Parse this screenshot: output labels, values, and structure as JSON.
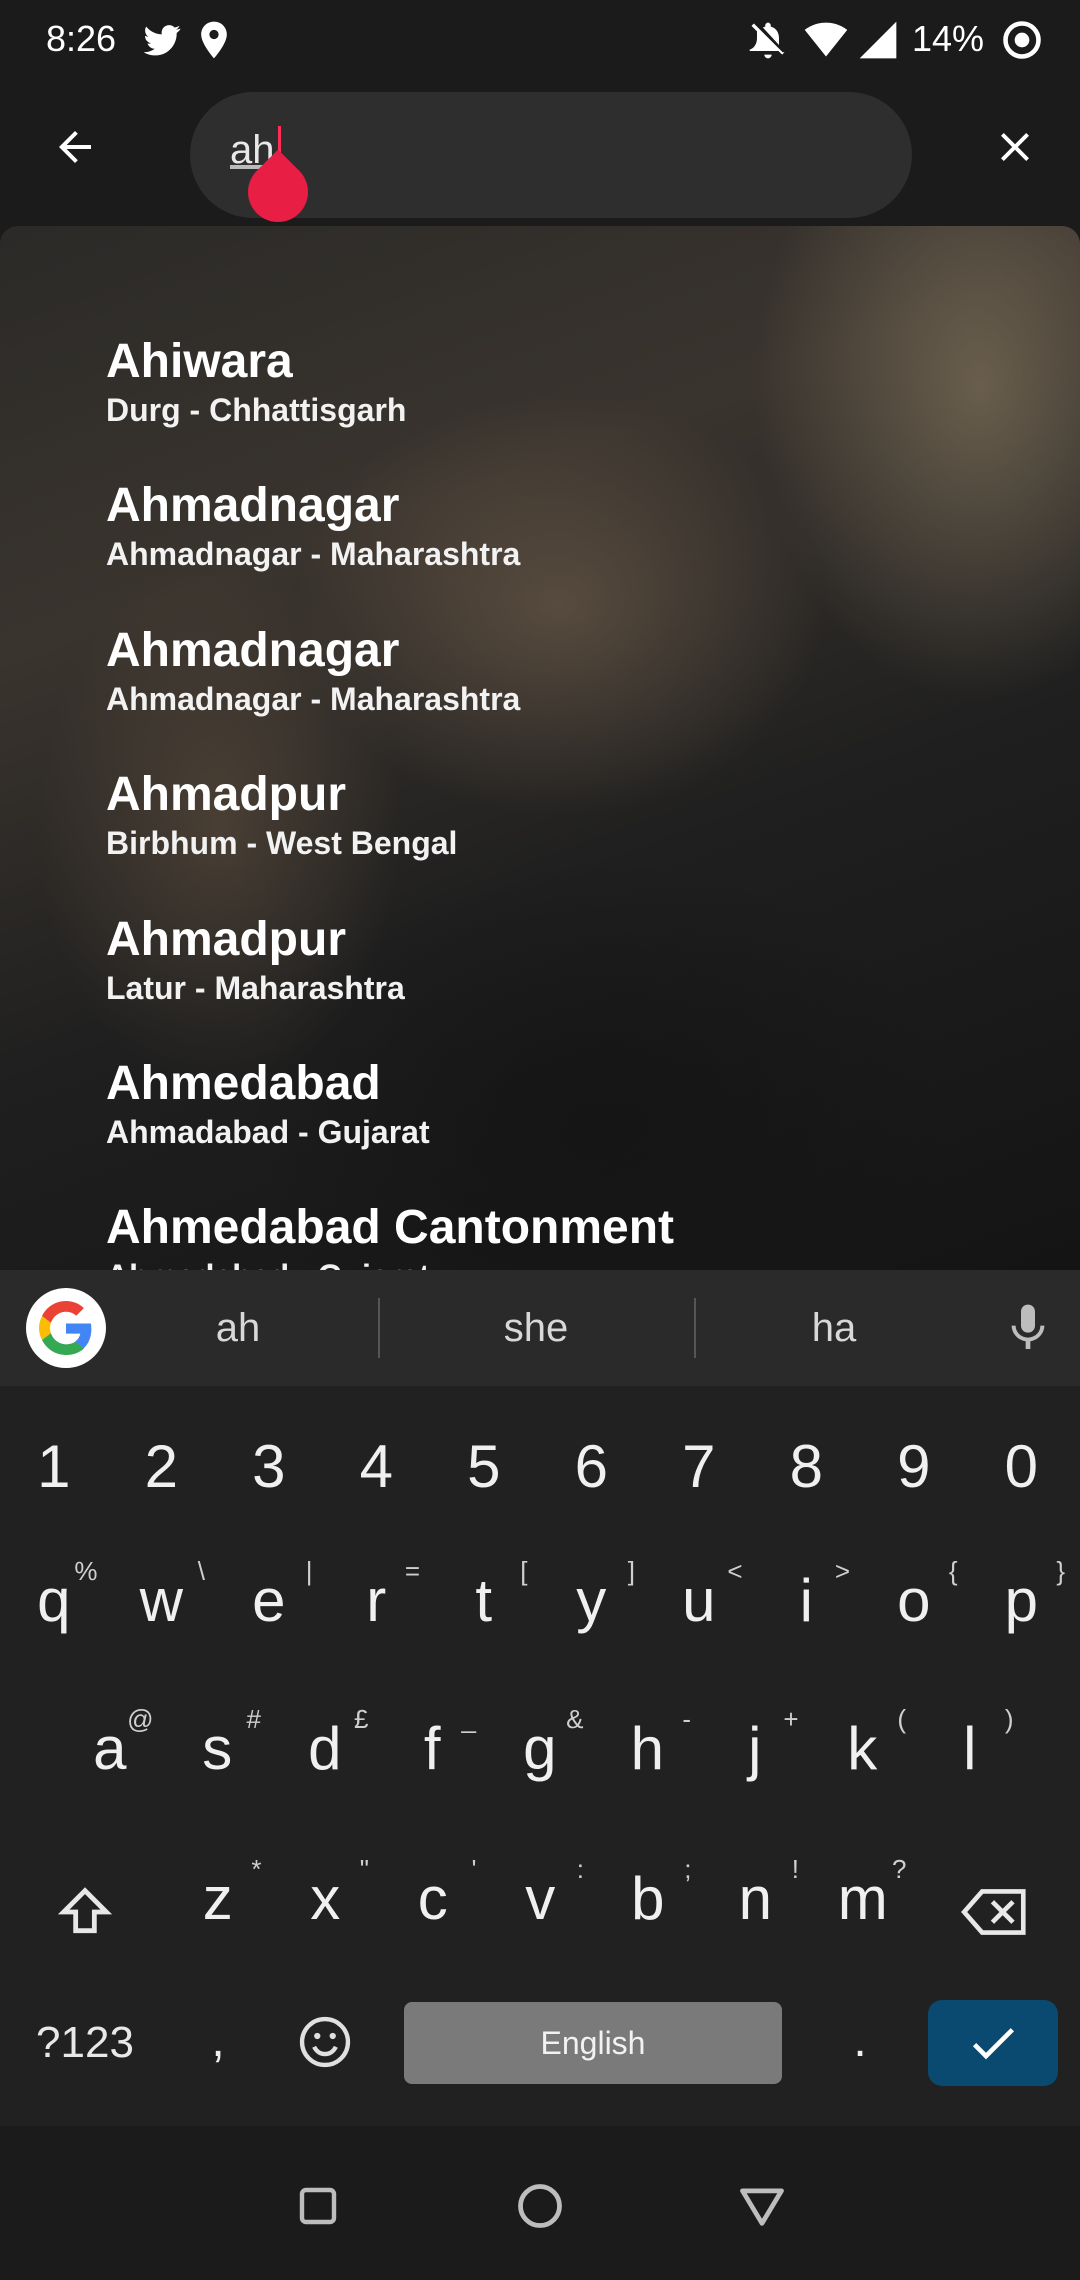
{
  "status_bar": {
    "time": "8:26",
    "battery": "14%"
  },
  "search": {
    "query": "ah"
  },
  "results": [
    {
      "title": "Ahiwara",
      "subtitle": "Durg  -  Chhattisgarh"
    },
    {
      "title": "Ahmadnagar",
      "subtitle": "Ahmadnagar  -  Maharashtra"
    },
    {
      "title": "Ahmadnagar",
      "subtitle": "Ahmadnagar  -  Maharashtra"
    },
    {
      "title": "Ahmadpur",
      "subtitle": "Birbhum  -  West Bengal"
    },
    {
      "title": "Ahmadpur",
      "subtitle": "Latur  -  Maharashtra"
    },
    {
      "title": "Ahmedabad",
      "subtitle": "Ahmadabad  -  Gujarat"
    },
    {
      "title": "Ahmedabad Cantonment",
      "subtitle": "Ahmadabad  -  Gujarat"
    }
  ],
  "keyboard": {
    "suggestions": [
      "ah",
      "she",
      "ha"
    ],
    "numbers": [
      "1",
      "2",
      "3",
      "4",
      "5",
      "6",
      "7",
      "8",
      "9",
      "0"
    ],
    "row1": [
      {
        "k": "q",
        "h": "%"
      },
      {
        "k": "w",
        "h": "\\"
      },
      {
        "k": "e",
        "h": "|"
      },
      {
        "k": "r",
        "h": "="
      },
      {
        "k": "t",
        "h": "["
      },
      {
        "k": "y",
        "h": "]"
      },
      {
        "k": "u",
        "h": "<"
      },
      {
        "k": "i",
        "h": ">"
      },
      {
        "k": "o",
        "h": "{"
      },
      {
        "k": "p",
        "h": "}"
      }
    ],
    "row2": [
      {
        "k": "a",
        "h": "@"
      },
      {
        "k": "s",
        "h": "#"
      },
      {
        "k": "d",
        "h": "£"
      },
      {
        "k": "f",
        "h": "_"
      },
      {
        "k": "g",
        "h": "&"
      },
      {
        "k": "h",
        "h": "-"
      },
      {
        "k": "j",
        "h": "+"
      },
      {
        "k": "k",
        "h": "("
      },
      {
        "k": "l",
        "h": ")"
      }
    ],
    "row3": [
      {
        "k": "z",
        "h": "*"
      },
      {
        "k": "x",
        "h": "\""
      },
      {
        "k": "c",
        "h": "'"
      },
      {
        "k": "v",
        "h": ":"
      },
      {
        "k": "b",
        "h": ";"
      },
      {
        "k": "n",
        "h": "!"
      },
      {
        "k": "m",
        "h": "?"
      }
    ],
    "symbols_label": "?123",
    "comma": ",",
    "period": ".",
    "space_label": "English"
  }
}
